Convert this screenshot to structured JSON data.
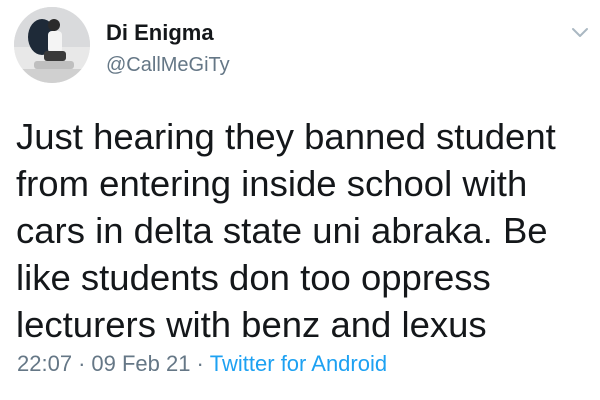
{
  "author": {
    "display_name": "Di Enigma",
    "handle": "@CallMeGiTy"
  },
  "tweet": {
    "text_lines": [
      "Just hearing they banned student",
      "from entering inside school with",
      "cars in delta state uni abraka. Be",
      "like students don too oppress",
      "lecturers with benz and lexus"
    ],
    "time": "22:07",
    "date": "09 Feb 21",
    "separator": "·",
    "source": "Twitter for Android"
  },
  "icons": {
    "menu": "chevron-down-icon",
    "avatar": "avatar"
  },
  "colors": {
    "text": "#14171a",
    "secondary": "#657786",
    "link": "#1da1f2",
    "caret": "#aab8c2"
  }
}
